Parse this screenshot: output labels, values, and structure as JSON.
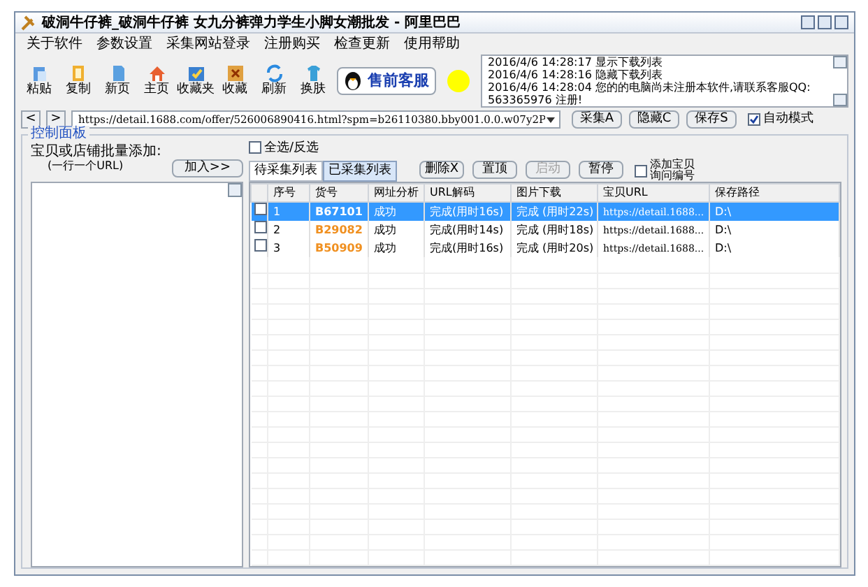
{
  "window": {
    "title": "破洞牛仔裤_破洞牛仔裤 女九分裤弹力学生小脚女潮批发 - 阿里巴巴"
  },
  "menu": [
    "关于软件",
    "参数设置",
    "采集网站登录",
    "注册购买",
    "检查更新",
    "使用帮助"
  ],
  "toolbar": [
    {
      "label": "粘贴",
      "kind": "paste"
    },
    {
      "label": "复制",
      "kind": "copy"
    },
    {
      "label": "新页",
      "kind": "page"
    },
    {
      "label": "主页",
      "kind": "home"
    },
    {
      "label": "收藏夹",
      "kind": "favorites"
    },
    {
      "label": "收藏",
      "kind": "star"
    },
    {
      "label": "刷新",
      "kind": "refresh"
    },
    {
      "label": "换肤",
      "kind": "shirt"
    }
  ],
  "support_button": "售前客服",
  "log": [
    "2016/4/6 14:28:17 显示下载列表",
    "2016/4/6 14:28:16 隐藏下载列表",
    "2016/4/6 14:28:04 您的的电脑尚未注册本软件,请联系客服QQ: 563365976 注册!"
  ],
  "nav": {
    "back": "<",
    "forward": ">"
  },
  "url": "https://detail.1688.com/offer/526006890416.html?spm=b26110380.bby001.0.0.w07y2P",
  "url_buttons": [
    "采集A",
    "隐藏C",
    "保存S"
  ],
  "auto_mode": {
    "label": "自动模式",
    "checked": true
  },
  "panel": {
    "title": "控制面板",
    "add_label": "宝贝或店铺批量添加:",
    "add_hint": "(一行一个URL)",
    "add_button": "加入>>"
  },
  "select_all": {
    "label": "全选/反选",
    "checked": false
  },
  "tabs": [
    {
      "label": "待采集列表",
      "selected": false
    },
    {
      "label": "已采集列表",
      "selected": true
    }
  ],
  "actions": [
    {
      "label": "删除X",
      "disabled": false
    },
    {
      "label": "置顶",
      "disabled": false
    },
    {
      "label": "启动",
      "disabled": true
    },
    {
      "label": "暂停",
      "disabled": false
    }
  ],
  "ask_number": {
    "label": "添加宝贝询问编号",
    "checked": false
  },
  "table": {
    "columns": [
      "序号",
      "货号",
      "网址分析",
      "URL解码",
      "图片下载",
      "宝贝URL",
      "保存路径"
    ],
    "rows": [
      {
        "selected": true,
        "checked": false,
        "cells": [
          "1",
          "B67101",
          "成功",
          "完成(用时16s)",
          "完成 (用时22s)",
          "https://detail.1688...",
          "D:\\"
        ]
      },
      {
        "selected": false,
        "checked": false,
        "cells": [
          "2",
          "B29082",
          "成功",
          "完成(用时14s)",
          "完成 (用时18s)",
          "https://detail.1688...",
          "D:\\"
        ]
      },
      {
        "selected": false,
        "checked": false,
        "cells": [
          "3",
          "B50909",
          "成功",
          "完成(用时16s)",
          "完成 (用时20s)",
          "https://detail.1688...",
          "D:\\"
        ]
      }
    ]
  }
}
